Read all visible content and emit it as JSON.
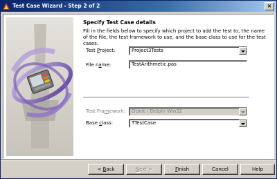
{
  "window": {
    "title": "Test Case Wizard - Step 2 of 2"
  },
  "heading": "Specify Test Case details",
  "description": "Fill in the fields below to specify which project to add the test to, the name of the file, the test framework to use, and the base class to use for the test cases.",
  "fields": {
    "project": {
      "label": "Test Project:",
      "value": "Project3Tests"
    },
    "file_name": {
      "label": "File name:",
      "value": "TestArithmetic.pas"
    },
    "framework": {
      "label": "Test Framework:",
      "value": "DUnit / Delphi Win32"
    },
    "base_class": {
      "label": "Base class:",
      "value": "TTestCase"
    }
  },
  "buttons": {
    "back": "< Back",
    "next": "Next >",
    "finish": "Finish",
    "cancel": "Cancel",
    "help": "Help"
  },
  "colors": {
    "titlebar_start": "#0a246a",
    "titlebar_end": "#a6caf0",
    "face": "#d4d0c8"
  }
}
